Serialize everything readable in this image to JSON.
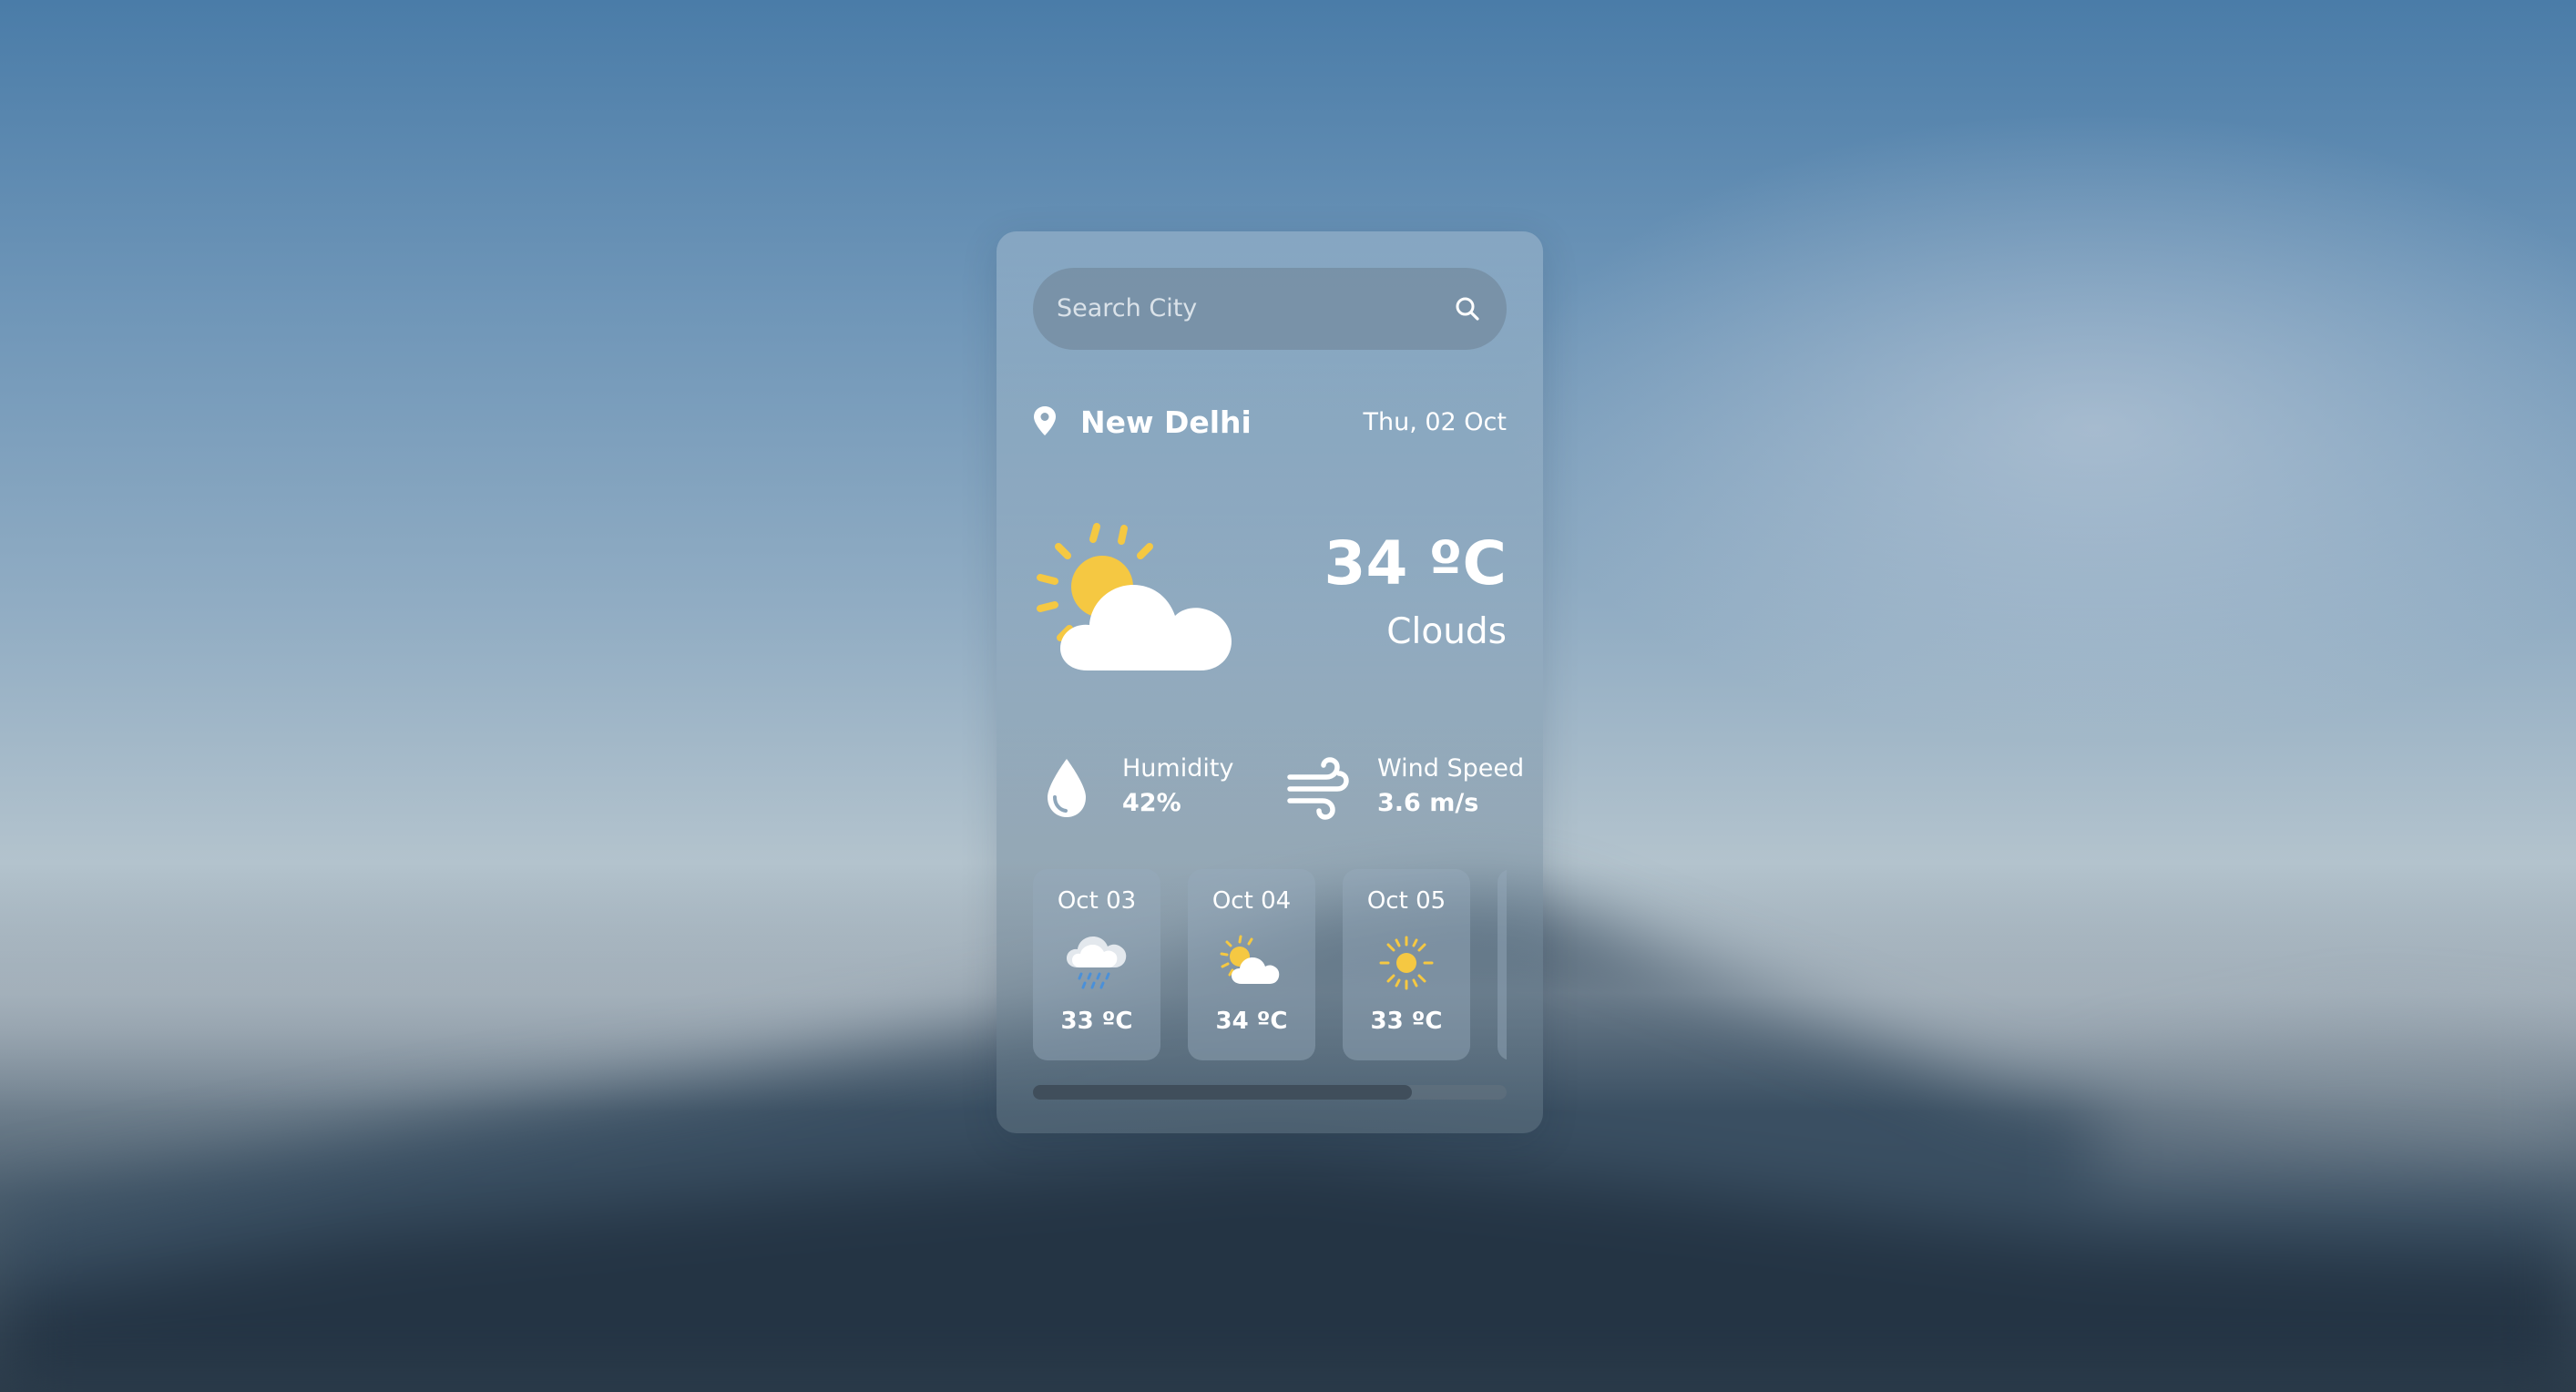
{
  "search": {
    "placeholder": "Search City",
    "icon": "search-icon"
  },
  "location": {
    "city": "New Delhi",
    "date": "Thu, 02 Oct",
    "icon": "map-pin-icon"
  },
  "current": {
    "temperature": "34 ºC",
    "condition": "Clouds",
    "icon": "partly-cloudy-icon"
  },
  "stats": {
    "humidity": {
      "label": "Humidity",
      "value": "42%",
      "icon": "water-drop-icon"
    },
    "wind": {
      "label": "Wind Speed",
      "value": "3.6 m/s",
      "icon": "wind-icon"
    }
  },
  "forecast": [
    {
      "date": "Oct 03",
      "temp": "33 ºC",
      "icon": "rain-cloud-icon"
    },
    {
      "date": "Oct 04",
      "temp": "34 ºC",
      "icon": "partly-cloudy-icon"
    },
    {
      "date": "Oct 05",
      "temp": "33 ºC",
      "icon": "sun-icon"
    }
  ],
  "forecast_scroll": {
    "visible_fraction": 0.8
  },
  "colors": {
    "sun": "#f5c842",
    "cloud": "#ffffff",
    "rain": "#4a90d9",
    "text": "#ffffff"
  }
}
